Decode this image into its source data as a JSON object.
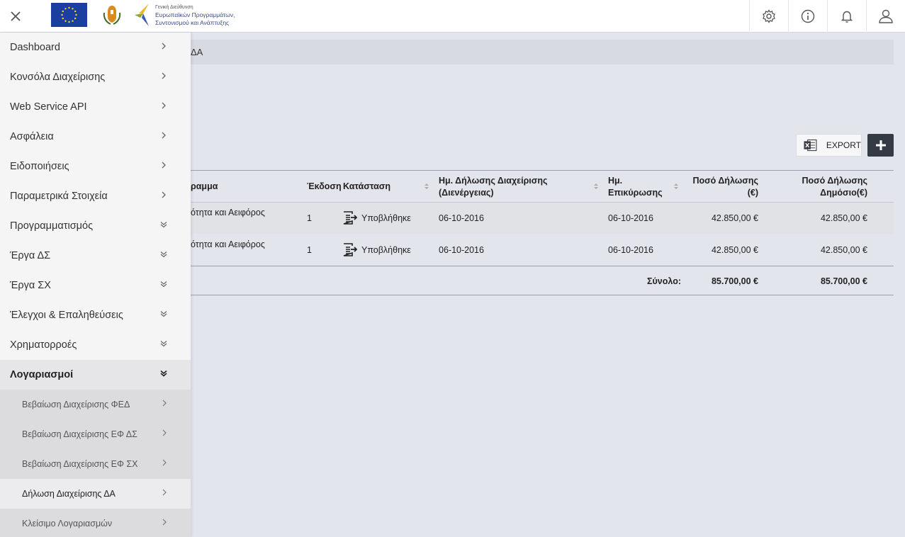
{
  "header": {
    "logo_text_line1": "Γενική Διεύθυνση",
    "logo_text_line2": "Ευρωπαϊκών Προγραμμάτων,",
    "logo_text_line3": "Συντονισμού και Ανάπτυξης",
    "icons": [
      "settings-icon",
      "info-icon",
      "notifications-icon",
      "user-icon"
    ]
  },
  "sidebar": {
    "items": [
      {
        "label": "Dashboard"
      },
      {
        "label": "Κονσόλα Διαχείρισης"
      },
      {
        "label": "Web Service API"
      },
      {
        "label": "Ασφάλεια"
      },
      {
        "label": "Ειδοποιήσεις"
      },
      {
        "label": "Παραμετρικά Στοιχεία"
      },
      {
        "label": "Προγραμματισμός"
      },
      {
        "label": "Έργα ΔΣ"
      },
      {
        "label": "Έργα ΣΧ"
      },
      {
        "label": "Έλεγχοι & Επαληθεύσεις"
      },
      {
        "label": "Χρηματορροές"
      },
      {
        "label": "Λογαριασμοί"
      }
    ],
    "subitems": [
      {
        "label": "Βεβαίωση Διαχείρισης ΦΕΔ"
      },
      {
        "label": "Βεβαίωση Διαχείρισης ΕΦ ΔΣ"
      },
      {
        "label": "Βεβαίωση Διαχείρισης ΕΦ ΣΧ"
      },
      {
        "label": "Δήλωση Διαχείρισης ΔΑ"
      },
      {
        "label": "Κλείσιμο Λογαριασμών"
      }
    ]
  },
  "breadcrumb": {
    "text": "ΔΑ"
  },
  "toolbar": {
    "export_label": "EXPORT"
  },
  "table": {
    "headers": {
      "program": "ραμμα",
      "version": "Έκδοση",
      "status": "Κατάσταση",
      "decl_date_line1": "Ημ. Δήλωσης Διαχείρισης",
      "decl_date_line2": "(Διενέργειας)",
      "confirm_date_line1": "Ημ.",
      "confirm_date_line2": "Επικύρωσης",
      "amount_line1": "Ποσό Δήλωσης",
      "amount_line2": "(€)",
      "public_line1": "Ποσό Δήλωσης",
      "public_line2": "Δημόσιο(€)"
    },
    "rows": [
      {
        "program": "ότητα και Αειφόρος",
        "version": "1",
        "status": "Υποβλήθηκε",
        "decl_date": "06-10-2016",
        "confirm_date": "06-10-2016",
        "amount": "42.850,00 €",
        "public_amount": "42.850,00 €"
      },
      {
        "program": "ότητα και Αειφόρος",
        "version": "1",
        "status": "Υποβλήθηκε",
        "decl_date": "06-10-2016",
        "confirm_date": "06-10-2016",
        "amount": "42.850,00 €",
        "public_amount": "42.850,00 €"
      }
    ],
    "total_label": "Σύνολο:",
    "total_amount": "85.700,00 €",
    "total_public": "85.700,00 €"
  }
}
